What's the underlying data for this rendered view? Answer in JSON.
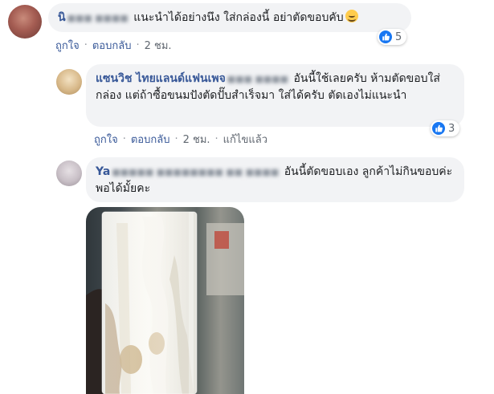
{
  "comments": [
    {
      "author_visible": "นิ",
      "author_blurred": "■■■ ■■■■",
      "text": "แนะนำได้อย่างนึง ใส่กล่องนี้ อย่าตัดขอบคับ",
      "emoji": "smiling-face-icon",
      "actions": {
        "like": "ถูกใจ",
        "reply": "ตอบกลับ",
        "time": "2 ชม."
      },
      "reactions": {
        "icon": "like-icon",
        "count": "5"
      }
    },
    {
      "author_visible": "แซนวิช ไทยแลนด์แฟนเพจ",
      "author_blurred": "■■■ ■■■■",
      "text": "อันนี้ใช้เลยครับ ห้ามตัดขอบใส่กล่อง แต่ถ้าซื้อขนมปังตัดปั๊บสำเร็จมา ใส่ได้ครับ ตัดเองไม่แนะนำ",
      "actions": {
        "like": "ถูกใจ",
        "reply": "ตอบกลับ",
        "time": "2 ชม.",
        "edited": "แก้ไขแล้ว"
      },
      "reactions": {
        "icon": "like-icon",
        "count": "3"
      }
    },
    {
      "author_visible": "Ya",
      "author_blurred": "■■■■■ ■■■■■■■■ ■■ ■■■■",
      "text": "อันนี้ตัดขอบเอง ลูกค้าไม่กินขอบค่ะ พอได้มั้ยคะ",
      "attachment": "sandwich-photo"
    }
  ],
  "colors": {
    "author": "#385898",
    "bubble": "#f2f3f5",
    "meta": "#606770",
    "like_blue": "#1877f2"
  }
}
